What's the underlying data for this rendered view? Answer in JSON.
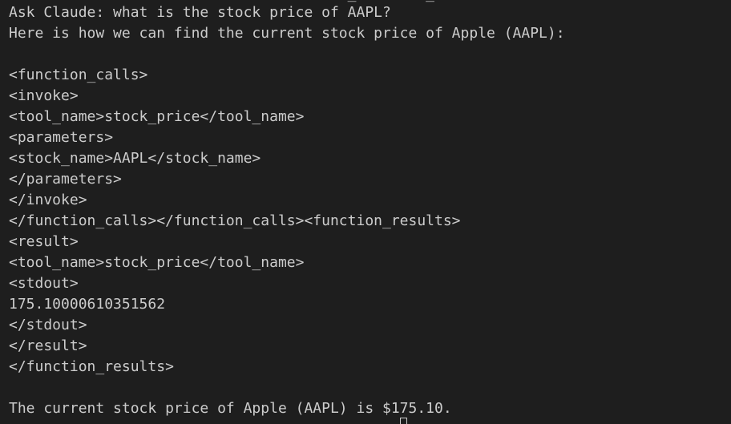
{
  "terminal": {
    "top_cutoff_line": "                                       _        _",
    "lines": [
      "Ask Claude: what is the stock price of AAPL?",
      "Here is how we can find the current stock price of Apple (AAPL):",
      "",
      "<function_calls>",
      "<invoke>",
      "<tool_name>stock_price</tool_name>",
      "<parameters>",
      "<stock_name>AAPL</stock_name>",
      "</parameters>",
      "</invoke>",
      "</function_calls></function_calls><function_results>",
      "<result>",
      "<tool_name>stock_price</tool_name>",
      "<stdout>",
      "175.10000610351562",
      "</stdout>",
      "</result>",
      "</function_results>",
      "",
      "The current stock price of Apple (AAPL) is $175.10."
    ],
    "bottom_cutoff_line": "    .   .     .  . . .   .      .     .  .  ."
  },
  "colors": {
    "background": "#1e1e1e",
    "foreground": "#cccccc"
  }
}
